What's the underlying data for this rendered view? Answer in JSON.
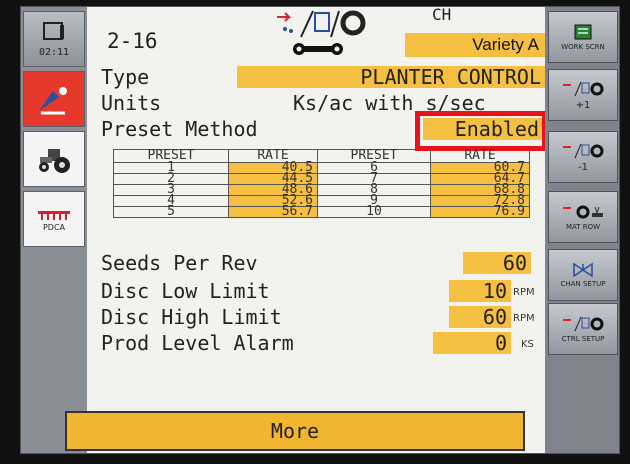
{
  "header": {
    "page_number": "2-16",
    "channel_label": "CH",
    "variety": "Variety A",
    "clock": "02:11"
  },
  "rows": {
    "type_label": "Type",
    "type_value": "PLANTER CONTROL",
    "units_label": "Units",
    "units_value": "Ks/ac with s/sec",
    "preset_label": "Preset Method",
    "preset_value": "Enabled"
  },
  "preset_table": {
    "headers": [
      "PRESET",
      "RATE",
      "PRESET",
      "RATE"
    ],
    "rows": [
      [
        "1",
        "40.5",
        "6",
        "60.7"
      ],
      [
        "2",
        "44.5",
        "7",
        "64.7"
      ],
      [
        "3",
        "48.6",
        "8",
        "68.8"
      ],
      [
        "4",
        "52.6",
        "9",
        "72.8"
      ],
      [
        "5",
        "56.7",
        "10",
        "76.9"
      ]
    ]
  },
  "settings": {
    "seeds_label": "Seeds Per Rev",
    "seeds_value": "60",
    "disc_low_label": "Disc Low Limit",
    "disc_low_value": "10",
    "disc_low_unit": "RPM",
    "disc_high_label": "Disc High Limit",
    "disc_high_value": "60",
    "disc_high_unit": "RPM",
    "prod_label": "Prod Level Alarm",
    "prod_value": "0",
    "prod_unit": "KS"
  },
  "more_label": "More",
  "left_sidebar": {
    "pdca_label": "PDCA"
  },
  "right_sidebar": {
    "work_screen": "WORK SCRN",
    "plus_one": "+1",
    "minus_one": "-1",
    "mat_row": "MAT ROW",
    "chan_setup": "CHAN SETUP",
    "ctrl_setup": "CTRL SETUP"
  },
  "colors": {
    "field_yellow": "#f5bf42",
    "highlight_red": "#e8131b"
  }
}
